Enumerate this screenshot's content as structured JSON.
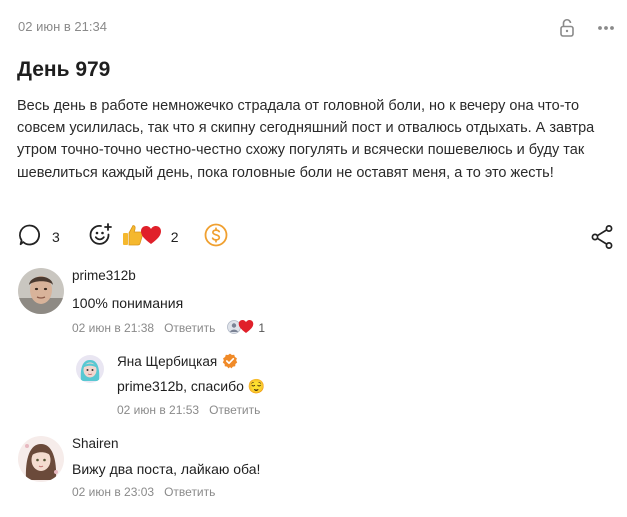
{
  "post": {
    "date": "02 июн в 21:34",
    "title": "День 979",
    "body": "Весь день в работе немножечко страдала от головной боли, но к вечеру она что-то совсем усилилась, так что я скипну сегодняшний пост и отвалюсь отдыхать. А завтра утром точно-точно честно-честно схожу погулять и всячески пошевелюсь и буду так шевелиться каждый день, пока головные боли не оставят меня, а то это жесть!",
    "comments_count": "3",
    "reactions_count": "2"
  },
  "comments": [
    {
      "author": "prime312b",
      "text": "100% понимания",
      "date": "02 июн в 21:38",
      "reply_label": "Ответить",
      "reactions_count": "1"
    },
    {
      "author": "Яна Щербицкая",
      "text": "prime312b, спасибо 😌",
      "date": "02 июн в 21:53",
      "reply_label": "Ответить"
    },
    {
      "author": "Shairen",
      "text": "Вижу два поста, лайкаю оба!",
      "date": "02 июн в 23:03",
      "reply_label": "Ответить"
    }
  ],
  "colors": {
    "accent_orange": "#f0a030",
    "heart_red": "#e0202a",
    "thumb_yellow": "#f5b82e",
    "muted_text": "#8a8a8a"
  },
  "icons": {
    "lock": "lock-open-icon",
    "more": "more-dots-icon",
    "comment": "comment-bubble-icon",
    "add_reaction": "add-reaction-icon",
    "donate": "donate-coin-icon",
    "share": "share-icon"
  }
}
